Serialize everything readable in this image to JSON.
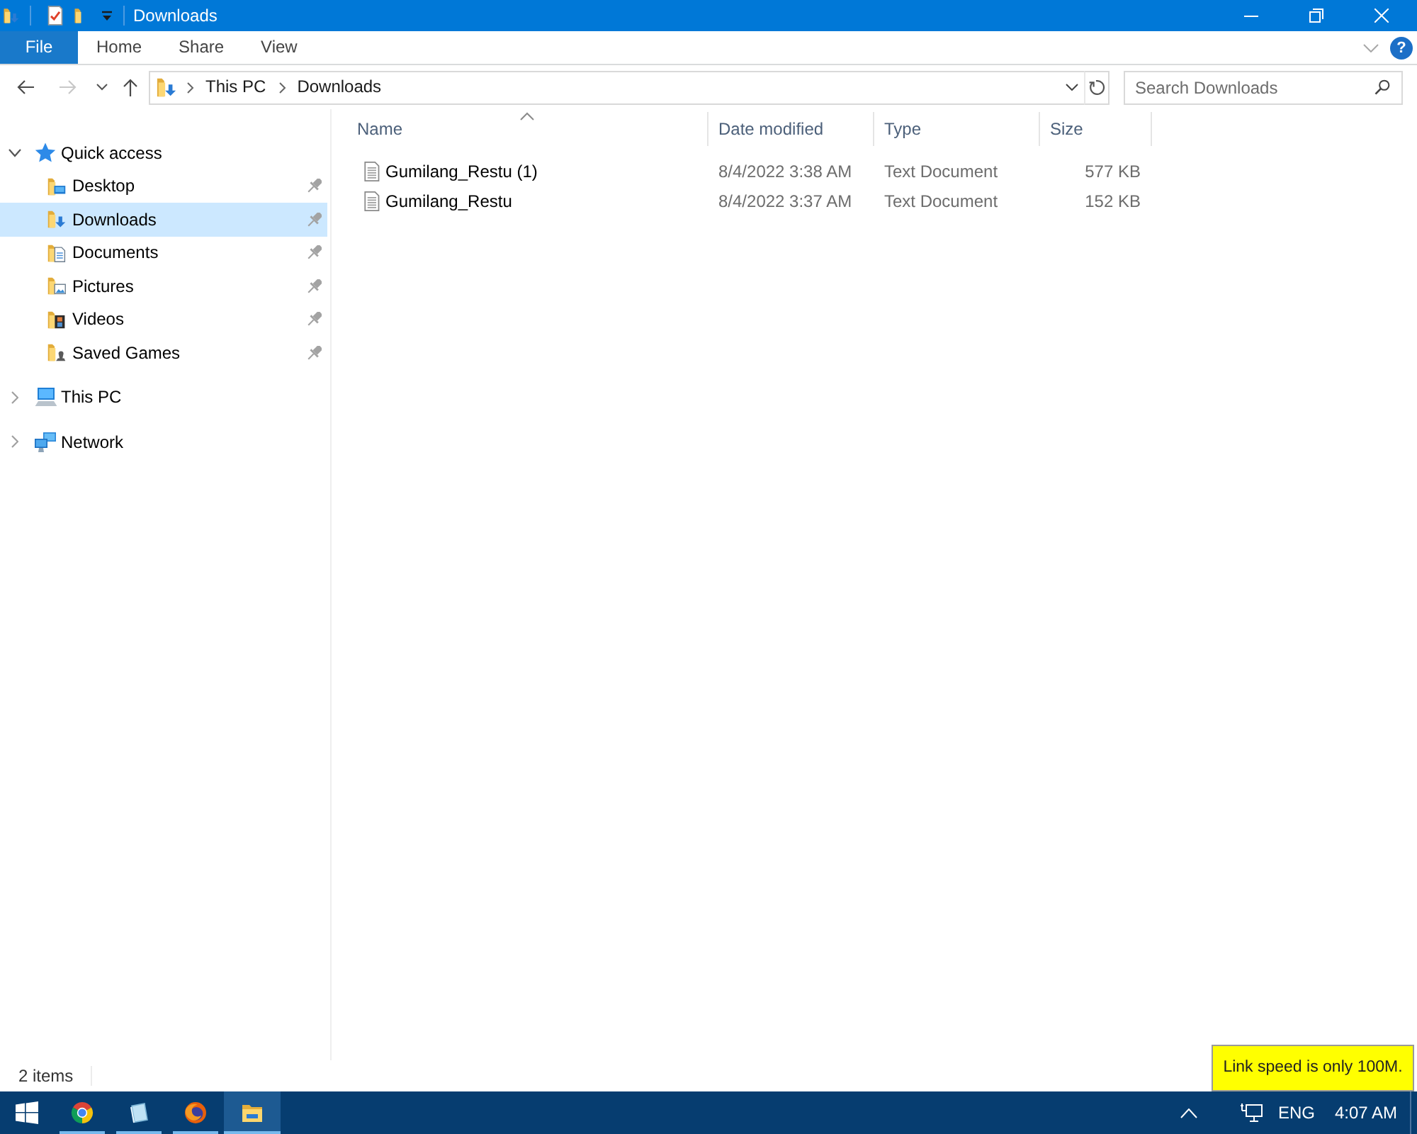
{
  "window": {
    "title": "Downloads"
  },
  "ribbon": {
    "tabs": [
      {
        "label": "File",
        "kind": "file"
      },
      {
        "label": "Home",
        "kind": "tab"
      },
      {
        "label": "Share",
        "kind": "tab"
      },
      {
        "label": "View",
        "kind": "tab"
      }
    ],
    "help": "?"
  },
  "toolbar": {
    "back": {
      "disabled": false
    },
    "forward": {
      "disabled": true
    },
    "breadcrumbs": [
      "This PC",
      "Downloads"
    ],
    "search": {
      "placeholder": "Search Downloads"
    }
  },
  "navigation_pane": {
    "items": [
      {
        "label": "Quick access",
        "expanded": true,
        "selected": false,
        "children": [
          {
            "label": "Desktop",
            "selected": false,
            "pinned": true
          },
          {
            "label": "Downloads",
            "selected": true,
            "pinned": true
          },
          {
            "label": "Documents",
            "selected": false,
            "pinned": true
          },
          {
            "label": "Pictures",
            "selected": false,
            "pinned": true
          },
          {
            "label": "Videos",
            "selected": false,
            "pinned": true
          },
          {
            "label": "Saved Games",
            "selected": false,
            "pinned": true
          }
        ]
      },
      {
        "label": "This PC",
        "expanded": false,
        "selected": false
      },
      {
        "label": "Network",
        "expanded": false,
        "selected": false
      }
    ]
  },
  "file_list": {
    "columns": [
      {
        "label": "Name",
        "sorted": true
      },
      {
        "label": "Date modified",
        "sorted": false
      },
      {
        "label": "Type",
        "sorted": false
      },
      {
        "label": "Size",
        "sorted": false
      }
    ],
    "rows": [
      {
        "cells": [
          "Gumilang_Restu (1)",
          "8/4/2022 3:38 AM",
          "Text Document",
          "577 KB"
        ]
      },
      {
        "cells": [
          "Gumilang_Restu",
          "8/4/2022 3:37 AM",
          "Text Document",
          "152 KB"
        ]
      }
    ]
  },
  "status_bar": {
    "text": "2 items"
  },
  "taskbar": {
    "apps": [
      {
        "running": true,
        "selected": false
      },
      {
        "running": true,
        "selected": false
      },
      {
        "running": true,
        "selected": false
      },
      {
        "running": true,
        "selected": true
      }
    ],
    "tray": {
      "language": "ENG",
      "time": "4:07 AM"
    }
  },
  "notification": {
    "text": "Link speed is only 100M."
  }
}
